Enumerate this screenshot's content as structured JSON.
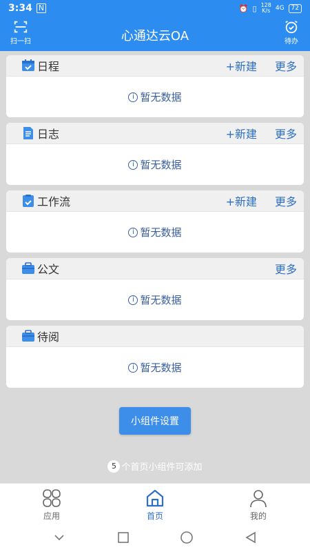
{
  "status_bar": {
    "time": "3:34",
    "nfc": "N",
    "speed_top": "128",
    "speed_bottom": "K/s",
    "signal": "4G",
    "battery": "72"
  },
  "header": {
    "title": "心通达云OA",
    "scan_label": "扫一扫",
    "todo_label": "待办",
    "color": "#2d8cf0"
  },
  "cards": [
    {
      "title": "日程",
      "icon": "calendar-icon",
      "new_label": "+新建",
      "more_label": "更多",
      "empty_text": "暂无数据"
    },
    {
      "title": "日志",
      "icon": "log-icon",
      "new_label": "+新建",
      "more_label": "更多",
      "empty_text": "暂无数据"
    },
    {
      "title": "工作流",
      "icon": "workflow-icon",
      "new_label": "+新建",
      "more_label": "更多",
      "empty_text": "暂无数据"
    },
    {
      "title": "公文",
      "icon": "document-icon",
      "more_label": "更多",
      "empty_text": "暂无数据"
    },
    {
      "title": "待阅",
      "icon": "to-read-icon",
      "empty_text": "暂无数据"
    }
  ],
  "info_glyph": "i",
  "widget": {
    "button_label": "小组件设置",
    "count": "5",
    "hint_text": "个首页小组件可添加"
  },
  "tabs": [
    {
      "label": "应用",
      "icon": "apps-icon",
      "active": false
    },
    {
      "label": "首页",
      "icon": "home-icon",
      "active": true
    },
    {
      "label": "我的",
      "icon": "user-icon",
      "active": false
    }
  ],
  "colors": {
    "accent": "#2d8cf0",
    "link": "#2d6fc4",
    "background": "#d9d9d9"
  }
}
